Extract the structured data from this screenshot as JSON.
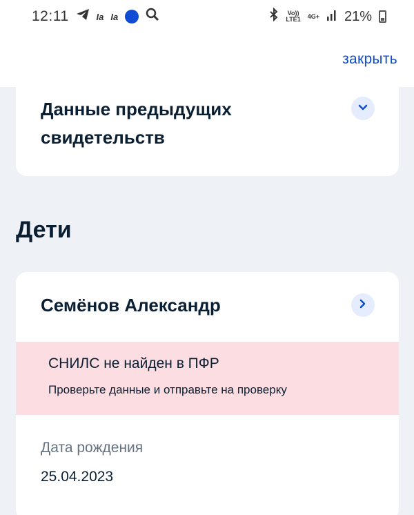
{
  "status_bar": {
    "time": "12:11",
    "app_icon_1": "Ia",
    "app_icon_2": "Ia",
    "network_1": "Vo))",
    "network_1b": "LTE1",
    "network_2": "4G+",
    "battery": "21%",
    "icons": [
      "telegram-icon",
      "gosuslugi-icon",
      "search-icon",
      "bluetooth-icon",
      "signal-icon",
      "battery-icon"
    ]
  },
  "header": {
    "close_label": "закрыть",
    "accent_color": "#0d4cd3"
  },
  "prev_certificates": {
    "title_line1": "Данные предыдущих",
    "title_line2": "свидетельств",
    "icon": "chevron-down-icon"
  },
  "children_section": {
    "title": "Дети"
  },
  "child": {
    "name": "Семёнов Александр",
    "icon": "chevron-right-icon",
    "error_title": "СНИЛС не найден в ПФР",
    "error_subtitle": "Проверьте данные и отправьте на проверку",
    "birth_label": "Дата рождения",
    "birth_value": "25.04.2023"
  }
}
